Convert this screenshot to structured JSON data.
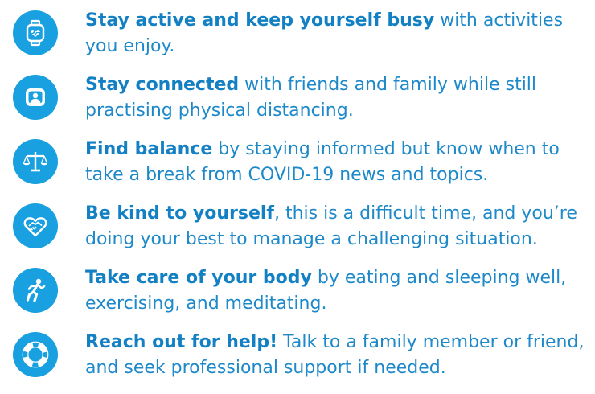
{
  "tips": [
    {
      "icon": "smartwatch-heart-icon",
      "bold": "Stay active and keep yourself busy",
      "rest": " with activities you enjoy."
    },
    {
      "icon": "video-call-person-icon",
      "bold": "Stay connected",
      "rest": " with friends and family while still practising physical distancing."
    },
    {
      "icon": "balance-scale-icon",
      "bold": "Find balance",
      "rest": " by staying informed but know when to take a break from COVID-19 news and topics."
    },
    {
      "icon": "heart-handshake-icon",
      "bold": "Be kind to yourself",
      "rest": ", this is a difficult time, and you’re doing your best to manage a challenging situation."
    },
    {
      "icon": "running-person-icon",
      "bold": "Take care of your body",
      "rest": " by eating and sleeping well, exercising, and meditating."
    },
    {
      "icon": "lifebuoy-icon",
      "bold": "Reach out for help!",
      "rest": " Talk to a family member or friend, and seek professional support if needed."
    }
  ],
  "colors": {
    "icon_bg": "#19a0e0",
    "text": "#1e89c9",
    "bold_text": "#1380c4",
    "background": "#ffffff"
  }
}
